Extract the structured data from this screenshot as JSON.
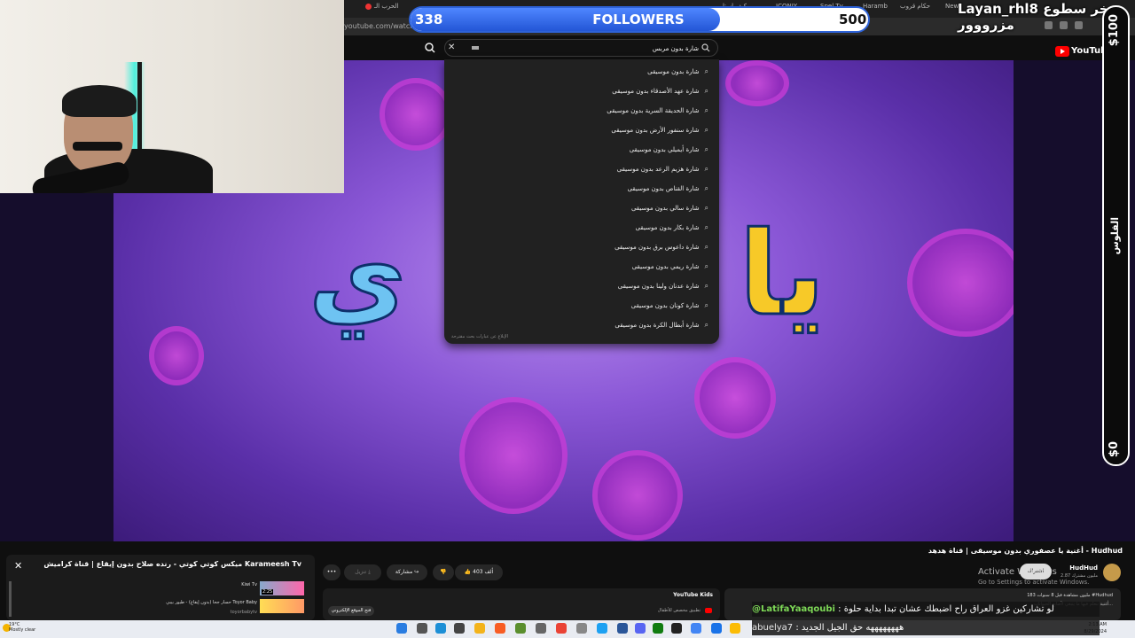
{
  "browser": {
    "tabs": [
      "ﺍﻟﺤﺮﺏ ﺍﻟـ",
      "ﻛﻴﻒ ﺍﺳﺘﺎ",
      "ICONIY",
      "Spel Tv",
      "Haramb",
      "ﺣﻜﺎﻡ ﻗﺮﻭﺏ",
      "New"
    ],
    "url": "youtube.com/watch?v="
  },
  "stream": {
    "username": "Layan_rhl8 ﺧﺮ ﺳﻄﻮﻉ ﻣﺰﺭﻭﻭﻭﺭ",
    "followers": {
      "current": "338",
      "label": "FOLLOWERS",
      "goal": "500",
      "progress": 0.676
    },
    "donation": {
      "max": "$100",
      "label": "ﺍﻟﻔﻠﻮﺱ",
      "min": "$0"
    }
  },
  "youtube": {
    "logo_text": "YouTube",
    "search_value": "ﺷﺎﺭﺓ ﺑﺪﻭﻥ ﻣﺮﺑﺲ",
    "suggestions": [
      "ﺷﺎﺭﺓ ﺑﺪﻭﻥ ﻣﻮﺳﻴﻘﻰ",
      "ﺷﺎﺭﺓ ﻋﻬﺪ ﺍﻷﺻﺪﻗﺎﺀ ﺑﺪﻭﻥ ﻣﻮﺳﻴﻘﻰ",
      "ﺷﺎﺭﺓ ﺍﻟﺤﺪﻳﻘﺔ ﺍﻟﺴﺮﻳﺔ ﺑﺪﻭﻥ ﻣﻮﺳﻴﻘﻰ",
      "ﺷﺎﺭﺓ ﺳﻨﻔﻮﺭ ﺍﻷﺭﺽ ﺑﺪﻭﻥ ﻣﻮﺳﻴﻘﻰ",
      "ﺷﺎﺭﺓ ﺃﻳﻤﻴﻠﻲ ﺑﺪﻭﻥ ﻣﻮﺳﻴﻘﻰ",
      "ﺷﺎﺭﺓ ﻫﺰﻳﻢ ﺍﻟﺮﻋﺪ ﺑﺪﻭﻥ ﻣﻮﺳﻴﻘﻰ",
      "ﺷﺎﺭﺓ ﺍﻟﻘﻨﺎﺹ ﺑﺪﻭﻥ ﻣﻮﺳﻴﻘﻰ",
      "ﺷﺎﺭﺓ ﺳﺎﻟﻲ ﺑﺪﻭﻥ ﻣﻮﺳﻴﻘﻰ",
      "ﺷﺎﺭﺓ ﺑﻜﺎﺭ ﺑﺪﻭﻥ ﻣﻮﺳﻴﻘﻰ",
      "ﺷﺎﺭﺓ ﺩﺍﻋﻮﺱ ﺑﺮﻕ ﺑﺪﻭﻥ ﻣﻮﺳﻴﻘﻰ",
      "ﺷﺎﺭﺓ ﺭﻳﻤﻲ ﺑﺪﻭﻥ ﻣﻮﺳﻴﻘﻰ",
      "ﺷﺎﺭﺓ ﻋﺪﻧﺎﻥ ﻭﻟﻴﻨﺎ ﺑﺪﻭﻥ ﻣﻮﺳﻴﻘﻰ",
      "ﺷﺎﺭﺓ ﻛﻮﻧﺎﻥ ﺑﺪﻭﻥ ﻣﻮﺳﻴﻘﻰ",
      "ﺷﺎﺭﺓ ﺃﺑﻄﺎﻝ ﺍﻟﻜﺮﺓ ﺑﺪﻭﻥ ﻣﻮﺳﻴﻘﻰ"
    ],
    "report_text": "ﺍﻹﺑﻼﻍ ﻋﻦ ﻋﺒﺎﺭﺍﺕ ﺑﺤﺚ ﻣﻘﺘﺮﺣﺔ",
    "video": {
      "title": "ﺃﻏﻨﻴﺔ ﻳﺎ ﻋﺼﻔﻮﺭﻱ ﺑﺪﻭﻥ ﻣﻮﺳﻴﻘﻰ | ﻗﻨﺎﺓ ﻫﺪﻫﺪ - Hudhud",
      "channel": "HudHud",
      "subs": "2.87 ﻣﻠﻴﻮﻥ ﻣﺸﺘﺮﻙ",
      "subscribe_label": "ﺍﺷﺘﺮﺍﻙ",
      "likes": "403 ﺃﻟﻒ",
      "share_label": "ﻣﺸﺎﺭﻛﺔ",
      "download_label": "ﺗﻨﺰﻳﻞ",
      "more": "•••",
      "views_line": "183 ﻣﻠﻴﻮﻥ ﻣﺸﺎﻫﺪﺓ ﻗﺒﻞ 8 ﺳﻨﻮﺍﺕ #Hudhud",
      "desc_line": "ﺃﻏﻨﻴﺔ ﺗﺘﻌﻠﻢ ﻓﻴﻬﺎ ﻣﺎ ﻳﻨﺒﻐﻲ ﻷﺻﺎﺑﻊ ﺍﻟﺤﻴﻮﺍﻧﺎﺕ..."
    },
    "kids": {
      "title": "YouTube Kids",
      "sub": "ﺗﻄﺒﻴﻖ ﻣﺨﺼﺺ ﻟﻸﻃﻔﺎﻝ",
      "button": "ﻓﺘﺢ ﺍﻟﻤﻮﻗﻊ ﺍﻹﻟﻜﺘﺮﻭﻧﻲ"
    },
    "activate": {
      "title": "Activate Windows",
      "sub": "Go to Settings to activate Windows."
    }
  },
  "miniplayer": {
    "title": "ﻣﻴﻜﺲ ﻛﻮﺗﻲ ﻛﻮﺗﻲ - ﺭﻧﺪﻩ ﺻﻼﺡ ﺑﺪﻭﻥ ﺇﻳﻘﺎﻉ | ﻗﻨﺎﺓ ﻛﺮﺍﻣﻴﺶ Karameesh Tv",
    "items": [
      {
        "title": "Kiwi Tv",
        "duration": "2:25"
      },
      {
        "title": "ﺣﺴﺎﺭ ﺟﺤﺎ (ﺑﺪﻭﻥ ﺇﻳﻘﺎﻉ) - ﻃﻴﻮﺭ ﺑﻴﺒﻲ Toyor Baby",
        "duration": "",
        "channel": "toyorbabytv"
      }
    ]
  },
  "chat": [
    {
      "user": "@LatifaYaaqoubi",
      "message": ": ﻟﻮ ﺗﺸﺎﺭﻛﻴﻦ ﻏﺰﻭ ﺍﻟﻌﺮﺍﻕ ﺭﺍﺡ ﺍﺿﺒﻄﻚ ﻋﺸﺎﻥ ﺗﺒﺪﺍ ﺑﺪﺍﻳﺔ ﺣﻠﻮﺓ"
    },
    {
      "user": "abuelya7",
      "message": ": ﻫﻬﻬﻬﻬﻬﻬﻬﻪ ﺣﻖ ﺍﻟﺠﻴﻞ ﺍﻟﺠﺪﻳﺪ"
    }
  ],
  "taskbar": {
    "weather_temp": "19°C",
    "weather_desc": "Mostly clear",
    "time": "2:13 AM",
    "date": "8/29/2024"
  },
  "colors": {
    "accent": "#2356d6",
    "chat_user": "#7ed957",
    "yt_red": "#ff0000"
  }
}
